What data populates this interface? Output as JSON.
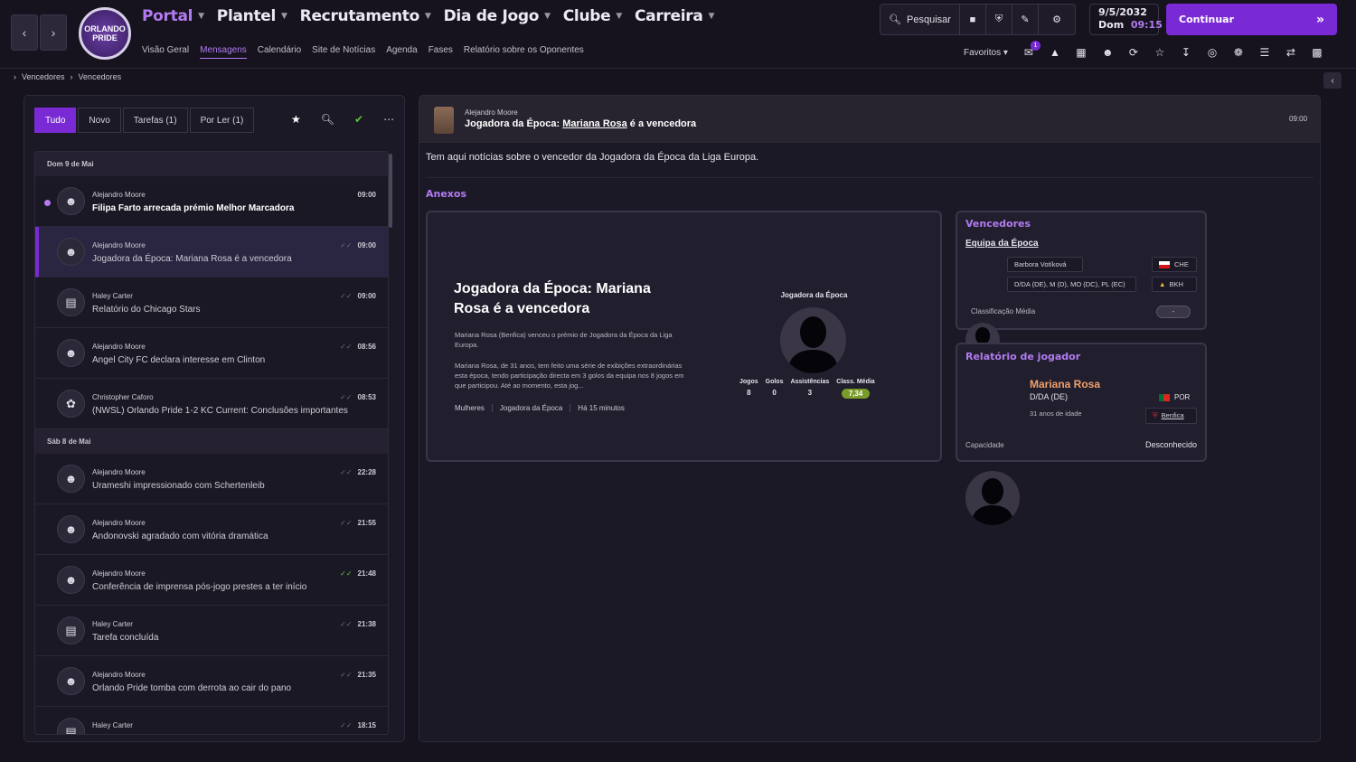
{
  "nav": {
    "main": [
      {
        "label": "Portal",
        "active": true
      },
      {
        "label": "Plantel"
      },
      {
        "label": "Recrutamento"
      },
      {
        "label": "Dia de Jogo"
      },
      {
        "label": "Clube"
      },
      {
        "label": "Carreira"
      }
    ],
    "sub": [
      "Visão Geral",
      "Mensagens",
      "Calendário",
      "Site de Notícias",
      "Agenda",
      "Fases",
      "Relatório sobre os Oponentes"
    ],
    "sub_active": "Mensagens",
    "search_label": "Pesquisar",
    "date": "9/5/2032",
    "day": "Dom",
    "time": "09:15",
    "continue_label": "Continuar",
    "favorites_label": "Favoritos",
    "inbox_badge": "1",
    "crest_text": "ORLANDO PRIDE"
  },
  "breadcrumb": [
    "Vencedores",
    "Vencedores"
  ],
  "filters": [
    "Tudo",
    "Novo",
    "Tarefas (1)",
    "Por Ler (1)"
  ],
  "groups": [
    {
      "label": "Dom 9 de Mai",
      "messages": [
        {
          "sender": "Alejandro Moore",
          "subject": "Filipa Farto arrecada prémio Melhor Marcadora",
          "time": "09:00",
          "unread": true,
          "icon": "person-icon"
        },
        {
          "sender": "Alejandro Moore",
          "subject": "Jogadora da Época: Mariana Rosa é a vencedora",
          "time": "09:00",
          "selected": true,
          "icon": "person-icon"
        },
        {
          "sender": "Haley Carter",
          "subject": "Relatório do Chicago Stars",
          "time": "09:00",
          "icon": "briefcase-icon"
        },
        {
          "sender": "Alejandro Moore",
          "subject": "Angel City FC declara interesse em Clinton",
          "time": "08:56",
          "icon": "person-icon"
        },
        {
          "sender": "Christopher Caforo",
          "subject": "(NWSL) Orlando Pride 1-2 KC Current: Conclusões importantes",
          "time": "08:53",
          "icon": "group-icon"
        }
      ]
    },
    {
      "label": "Sáb 8 de Mai",
      "messages": [
        {
          "sender": "Alejandro Moore",
          "subject": "Urameshi impressionado com Schertenleib",
          "time": "22:28",
          "icon": "person-icon"
        },
        {
          "sender": "Alejandro Moore",
          "subject": "Andonovski agradado com vitória dramática",
          "time": "21:55",
          "icon": "person-icon"
        },
        {
          "sender": "Alejandro Moore",
          "subject": "Conferência de imprensa pós-jogo prestes a ter início",
          "time": "21:48",
          "green": true,
          "icon": "person-icon"
        },
        {
          "sender": "Haley Carter",
          "subject": "Tarefa concluída",
          "time": "21:38",
          "icon": "briefcase-icon"
        },
        {
          "sender": "Alejandro Moore",
          "subject": "Orlando Pride tomba com derrota ao cair do pano",
          "time": "21:35",
          "icon": "person-icon"
        },
        {
          "sender": "Haley Carter",
          "subject": "",
          "time": "18:15",
          "icon": "briefcase-icon"
        }
      ]
    }
  ],
  "message": {
    "from": "Alejandro Moore",
    "subject_pre": "Jogadora da Época: ",
    "subject_link": "Mariana Rosa",
    "subject_post": " é a vencedora",
    "time": "09:00",
    "body": "Tem aqui notícias sobre o vencedor da Jogadora da Época da Liga Europa.",
    "attachments_label": "Anexos"
  },
  "news_card": {
    "title": "Jogadora da Época: Mariana Rosa é a vencedora",
    "p1": "Mariana Rosa (Benfica) venceu o prémio de Jogadora da Época da Liga Europa.",
    "p2": "Mariana Rosa, de 31 anos, tem feito uma série de exibições extraordinárias esta época, tendo participação directa em 3 golos da equipa nos 8 jogos em que participou. Até ao momento, esta jog...",
    "tags": [
      "Mulheres",
      "Jogadora da Época",
      "Há 15 minutos"
    ],
    "award_label": "Jogadora da Época",
    "stats": [
      {
        "label": "Jogos",
        "value": "8"
      },
      {
        "label": "Golos",
        "value": "0"
      },
      {
        "label": "Assistências",
        "value": "3"
      },
      {
        "label": "Class. Média",
        "value": "7,34",
        "pill": true
      }
    ]
  },
  "winners_card": {
    "title": "Vencedores",
    "subtitle": "Equipa da Época",
    "player": "Barbora Votíková",
    "positions": "D/DA (DE), M (D), MO (DC), PL (EC)",
    "nation": "CHE",
    "club": "BKH",
    "rating_label": "Classificação Média",
    "rating_value": "-"
  },
  "report_card": {
    "title": "Relatório de jogador",
    "name": "Mariana Rosa",
    "position": "D/DA (DE)",
    "age": "31 anos de idade",
    "nation": "POR",
    "club": "Benfica",
    "ability_label": "Capacidade",
    "ability_value": "Desconhecido"
  },
  "colors": {
    "accent": "#7a2ad4",
    "accent_text": "#b27bf0",
    "rating": "#7a9a2a",
    "read_green": "#5cc23a"
  }
}
